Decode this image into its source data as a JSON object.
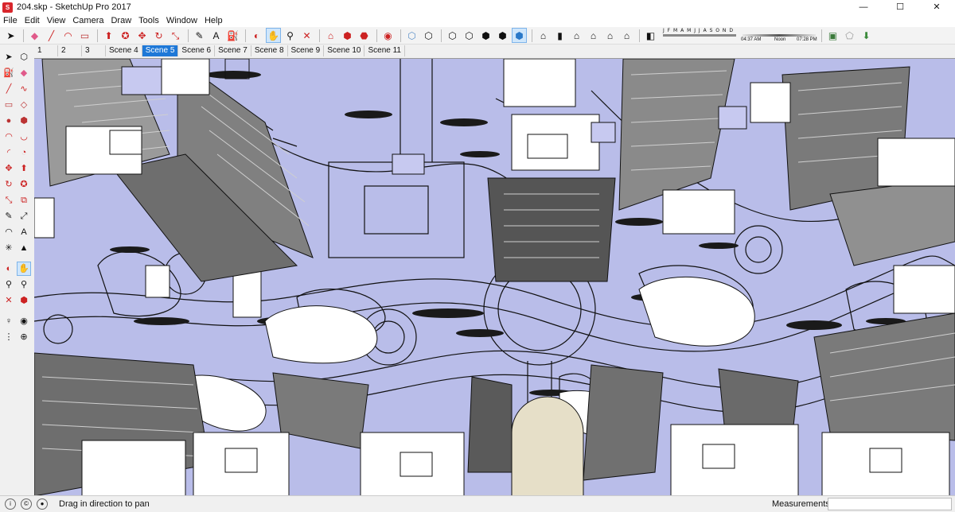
{
  "window": {
    "title": "204.skp - SketchUp Pro 2017",
    "app_icon": "sketchup-logo-icon",
    "minimize": "—",
    "maximize": "☐",
    "close": "✕"
  },
  "menu": [
    "File",
    "Edit",
    "View",
    "Camera",
    "Draw",
    "Tools",
    "Window",
    "Help"
  ],
  "toolbar": {
    "shadow_months": "J F M A M J J A S O N D",
    "shadow_time_start": "04:37 AM",
    "shadow_time_mid": "Noon",
    "shadow_time_end": "07:28 PM"
  },
  "scenes": [
    {
      "label": "1",
      "active": false
    },
    {
      "label": "2",
      "active": false
    },
    {
      "label": "3",
      "active": false
    },
    {
      "label": "Scene 4",
      "active": false
    },
    {
      "label": "Scene 5",
      "active": true
    },
    {
      "label": "Scene 6",
      "active": false
    },
    {
      "label": "Scene 7",
      "active": false
    },
    {
      "label": "Scene 8",
      "active": false
    },
    {
      "label": "Scene 9",
      "active": false
    },
    {
      "label": "Scene 10",
      "active": false
    },
    {
      "label": "Scene 11",
      "active": false
    }
  ],
  "status": {
    "hint": "Drag in direction to pan",
    "measurements_label": "Measurements",
    "measurements_value": ""
  },
  "colors": {
    "ground": "#b9bde9",
    "active_tab": "#1e78d7"
  }
}
